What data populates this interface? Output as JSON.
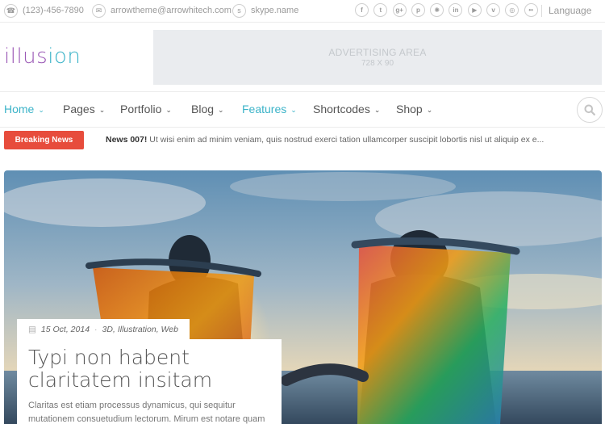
{
  "topbar": {
    "phone": "(123)-456-7890",
    "email": "arrowtheme@arrowhitech.com",
    "skype": "skype.name",
    "socials": [
      {
        "icon": "facebook-icon",
        "glyph": "f"
      },
      {
        "icon": "twitter-icon",
        "glyph": "t"
      },
      {
        "icon": "google-plus-icon",
        "glyph": "g+"
      },
      {
        "icon": "pinterest-icon",
        "glyph": "p"
      },
      {
        "icon": "dribbble-icon",
        "glyph": "✺"
      },
      {
        "icon": "linkedin-icon",
        "glyph": "in"
      },
      {
        "icon": "youtube-icon",
        "glyph": "▶"
      },
      {
        "icon": "vimeo-icon",
        "glyph": "v"
      },
      {
        "icon": "instagram-icon",
        "glyph": "◎"
      },
      {
        "icon": "flickr-icon",
        "glyph": "••"
      }
    ],
    "language": "Language"
  },
  "header": {
    "logo_part1": "illus",
    "logo_part2": "ion",
    "ad_title": "ADVERTISING AREA",
    "ad_size": "728 X 90"
  },
  "nav": {
    "items": [
      {
        "label": "Home",
        "active": true
      },
      {
        "label": "Pages",
        "active": false
      },
      {
        "label": "Portfolio",
        "active": false
      },
      {
        "label": "Blog",
        "active": false
      },
      {
        "label": "Features",
        "active": true
      },
      {
        "label": "Shortcodes",
        "active": false
      },
      {
        "label": "Shop",
        "active": false
      }
    ]
  },
  "breaking": {
    "label": "Breaking News",
    "headline_prefix": "News 007!",
    "headline_text": " Ut wisi enim ad minim veniam, quis nostrud exerci tation ullamcorper suscipit lobortis nisl ut aliquip ex e..."
  },
  "post": {
    "date": "15 Oct, 2014",
    "categories": [
      "3D",
      "Illustration",
      "Web"
    ],
    "title_line1": "Typi non habent",
    "title_line2": "claritatem insitam",
    "excerpt": "Claritas est etiam processus dynamicus, qui sequitur mutationem consuetudium lectorum. Mirum est notare quam"
  },
  "colors": {
    "accent": "#3bb3c8",
    "logo_purple": "#9b59b6",
    "breaking_red": "#e74c3c"
  }
}
